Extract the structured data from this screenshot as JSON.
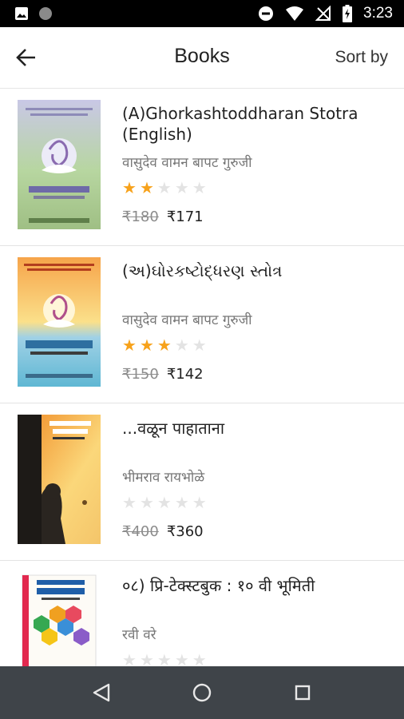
{
  "status_bar": {
    "time": "3:23",
    "left_icons": [
      "image-icon",
      "circle-icon"
    ],
    "right_icons": [
      "do-not-disturb-icon",
      "wifi-icon",
      "no-signal-icon",
      "battery-icon"
    ]
  },
  "toolbar": {
    "back_icon": "arrow-back-icon",
    "title": "Books",
    "sort_label": "Sort by"
  },
  "books": [
    {
      "title": "(A)Ghorkashtoddharan Stotra (English)",
      "author": "वासुदेव वामन बापट गुरुजी",
      "rating": 2,
      "max_rating": 5,
      "old_price": "₹180",
      "price": "₹171"
    },
    {
      "title": "(અ)ઘોરકષ્ટોદ્ધરણ સ્તોત્ર",
      "author": "वासुदेव वामन बापट गुरुजी",
      "rating": 3,
      "max_rating": 5,
      "old_price": "₹150",
      "price": "₹142"
    },
    {
      "title": "...वळून पाहाताना",
      "author": "भीमराव रायभोळे",
      "rating": 0,
      "max_rating": 5,
      "old_price": "₹400",
      "price": "₹360"
    },
    {
      "title": "०८) प्रि-टेक्स्टबुक : १० वी भूमिती",
      "author": "रवी वरे",
      "rating": 0,
      "max_rating": 5,
      "old_price": "",
      "price": ""
    }
  ],
  "colors": {
    "star_on": "#f7a21b",
    "star_off": "#e3e3e3",
    "nav_bar": "#3f4449",
    "status_bar": "#000000"
  },
  "nav_bar": {
    "icons": [
      "back-triangle-icon",
      "home-circle-icon",
      "recents-square-icon"
    ]
  }
}
